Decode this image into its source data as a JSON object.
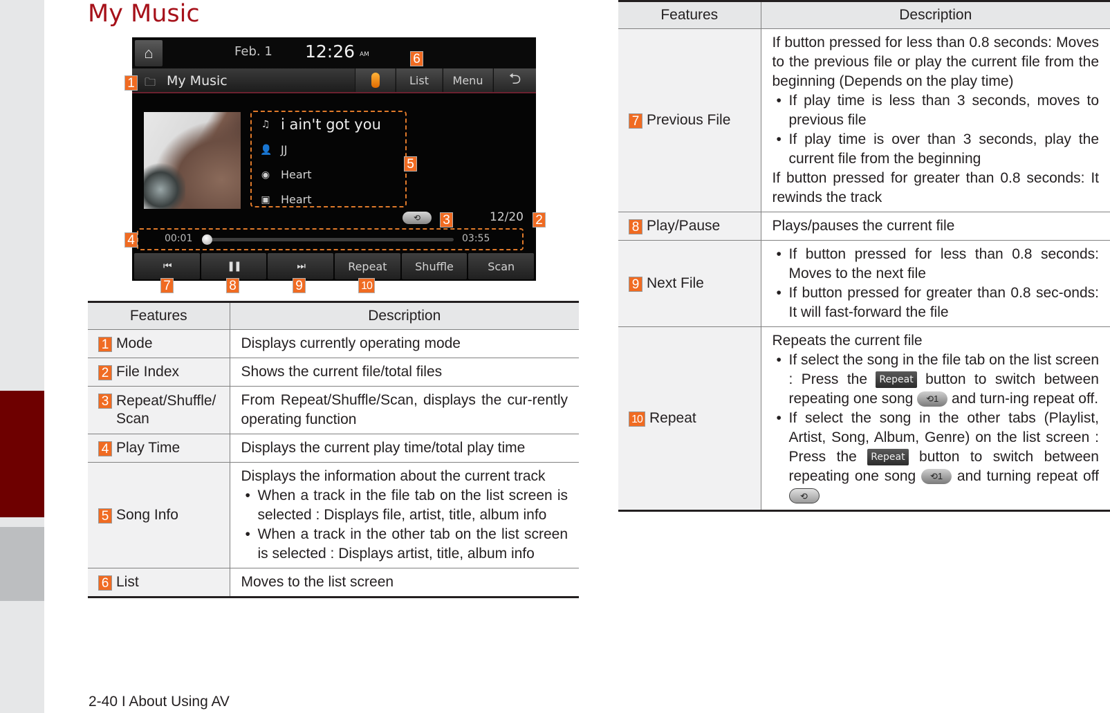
{
  "page": {
    "title": "My Music",
    "footer": "2-40 I  About Using AV"
  },
  "screen": {
    "date": "Feb.  1",
    "time": "12:26",
    "ampm": "AM",
    "mode_label": "My Music",
    "buttons": {
      "list": "List",
      "menu": "Menu",
      "back": "⮌"
    },
    "song": {
      "title": "i ain't got you",
      "artist": "JJ",
      "album": "Heart",
      "extra": "Heart"
    },
    "repeat_indicator": "⟲",
    "file_index": "12/20",
    "time_current": "00:01",
    "time_total": "03:55",
    "progress_fraction": 0.004,
    "controls": {
      "prev": "⏮",
      "pause": "❚❚",
      "next": "⏭",
      "repeat": "Repeat",
      "shuffle": "Shuffle",
      "scan": "Scan"
    },
    "callouts": [
      "1",
      "2",
      "3",
      "4",
      "5",
      "6",
      "7",
      "8",
      "9",
      "10"
    ]
  },
  "table_headers": {
    "features": "Features",
    "description": "Description"
  },
  "left_table": [
    {
      "num": "1",
      "feature": "Mode",
      "desc": "Displays currently operating mode"
    },
    {
      "num": "2",
      "feature": "File Index",
      "desc": "Shows the current file/total files"
    },
    {
      "num": "3",
      "feature": "Repeat/Shuffle/ Scan",
      "desc": "From Repeat/Shuffle/Scan, displays the cur-rently operating function"
    },
    {
      "num": "4",
      "feature": "Play Time",
      "desc": "Displays the current play time/total play time"
    },
    {
      "num": "5",
      "feature": "Song Info",
      "desc": "Displays the information about the current track",
      "bullets": [
        "When a track in the file tab on the list screen is selected : Displays file, artist, title, album info",
        "When a track in the other tab on the list screen is selected : Displays artist, title, album info"
      ]
    },
    {
      "num": "6",
      "feature": "List",
      "desc": "Moves to the list screen"
    }
  ],
  "right_table": {
    "prev": {
      "num": "7",
      "feature": "Previous File",
      "intro": "If button pressed for less than 0.8 seconds: Moves to the previous file or play the current file from the beginning (Depends on the play time)",
      "bullets": [
        "If play time is less than 3 seconds, moves to previous file",
        "If play time is over than 3 seconds, play the current file from the beginning"
      ],
      "outro": "If button pressed for greater than 0.8 seconds: It rewinds the track"
    },
    "play": {
      "num": "8",
      "feature": "Play/Pause",
      "desc": "Plays/pauses the current file"
    },
    "next": {
      "num": "9",
      "feature": "Next File",
      "bullets": [
        "If button pressed for less than 0.8 seconds: Moves to the next file",
        "If button pressed for greater than 0.8 sec-onds: It will fast-forward the file"
      ]
    },
    "repeat": {
      "num": "10",
      "feature": "Repeat",
      "intro": "Repeats the current file",
      "b1_a": "If select the song in the file tab on the list screen : Press the",
      "b1_btn": "Repeat",
      "b1_b": "button to switch between repeating one song",
      "b1_c": "and turn-ing repeat off.",
      "b2_a": "If select the song in the other tabs (Playlist, Artist, Song, Album, Genre) on the list screen : Press the",
      "b2_btn": "Repeat",
      "b2_b": "button to switch between repeating one song",
      "b2_c": "and turning repeat off",
      "icon_one": "⟲1",
      "icon_off": "⟲"
    }
  }
}
